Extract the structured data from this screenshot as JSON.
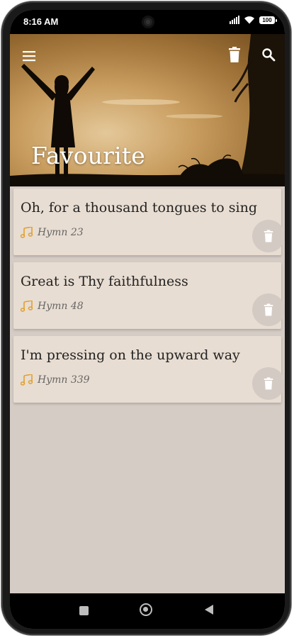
{
  "status_bar": {
    "time": "8:16 AM",
    "battery": "100"
  },
  "header": {
    "title": "Favourite",
    "icons": [
      "menu-icon",
      "trash-icon",
      "search-icon"
    ]
  },
  "favourites": [
    {
      "title": "Oh, for a thousand tongues to sing",
      "hymn": "Hymn 23"
    },
    {
      "title": "Great is Thy faithfulness",
      "hymn": "Hymn 48"
    },
    {
      "title": "I'm pressing on the upward way",
      "hymn": "Hymn 339"
    }
  ],
  "colors": {
    "card_bg": "#e8ddd2",
    "screen_bg": "#d6ccc6",
    "note_accent": "#e0a030",
    "delete_circle": "#d4cac4"
  }
}
